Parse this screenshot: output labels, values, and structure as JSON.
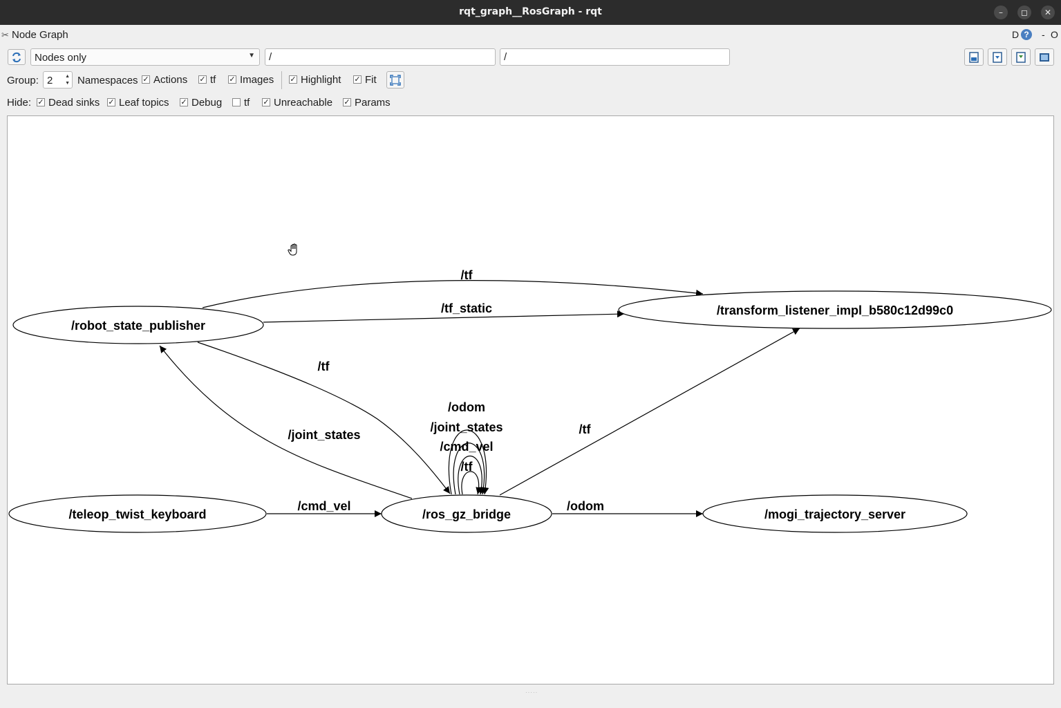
{
  "window": {
    "title": "rqt_graph__RosGraph - rqt",
    "minimize": "–",
    "maximize": "◻",
    "close": "✕"
  },
  "dock": {
    "title": "Node Graph",
    "d_label": "D",
    "help": "?",
    "dash": "-",
    "o_label": "O"
  },
  "toolbar": {
    "view_mode": "Nodes only",
    "node_filter": "/",
    "topic_filter": "/"
  },
  "group_row": {
    "group_label": "Group:",
    "group_value": "2",
    "namespaces": "Namespaces",
    "options": [
      {
        "label": "Actions",
        "checked": true
      },
      {
        "label": "tf",
        "checked": true
      },
      {
        "label": "Images",
        "checked": true
      },
      {
        "label": "Highlight",
        "checked": true
      },
      {
        "label": "Fit",
        "checked": true
      }
    ]
  },
  "hide_row": {
    "hide_label": "Hide:",
    "options": [
      {
        "label": "Dead sinks",
        "checked": true
      },
      {
        "label": "Leaf topics",
        "checked": true
      },
      {
        "label": "Debug",
        "checked": true
      },
      {
        "label": "tf",
        "checked": false
      },
      {
        "label": "Unreachable",
        "checked": true
      },
      {
        "label": "Params",
        "checked": true
      }
    ]
  },
  "graph": {
    "nodes": {
      "robot_state_publisher": "/robot_state_publisher",
      "transform_listener": "/transform_listener_impl_b580c12d99c0",
      "teleop": "/teleop_twist_keyboard",
      "ros_gz_bridge": "/ros_gz_bridge",
      "mogi": "/mogi_trajectory_server"
    },
    "edges": {
      "rsp_to_tl_tf": "/tf",
      "rsp_to_tl_tf_static": "/tf_static",
      "rsp_to_bridge_tf": "/tf",
      "bridge_to_rsp_joint_states": "/joint_states",
      "bridge_to_tl_tf": "/tf",
      "teleop_to_bridge_cmd_vel": "/cmd_vel",
      "bridge_to_mogi_odom": "/odom",
      "self_odom": "/odom",
      "self_joint_states": "/joint_states",
      "self_cmd_vel": "/cmd_vel",
      "self_tf": "/tf"
    }
  }
}
